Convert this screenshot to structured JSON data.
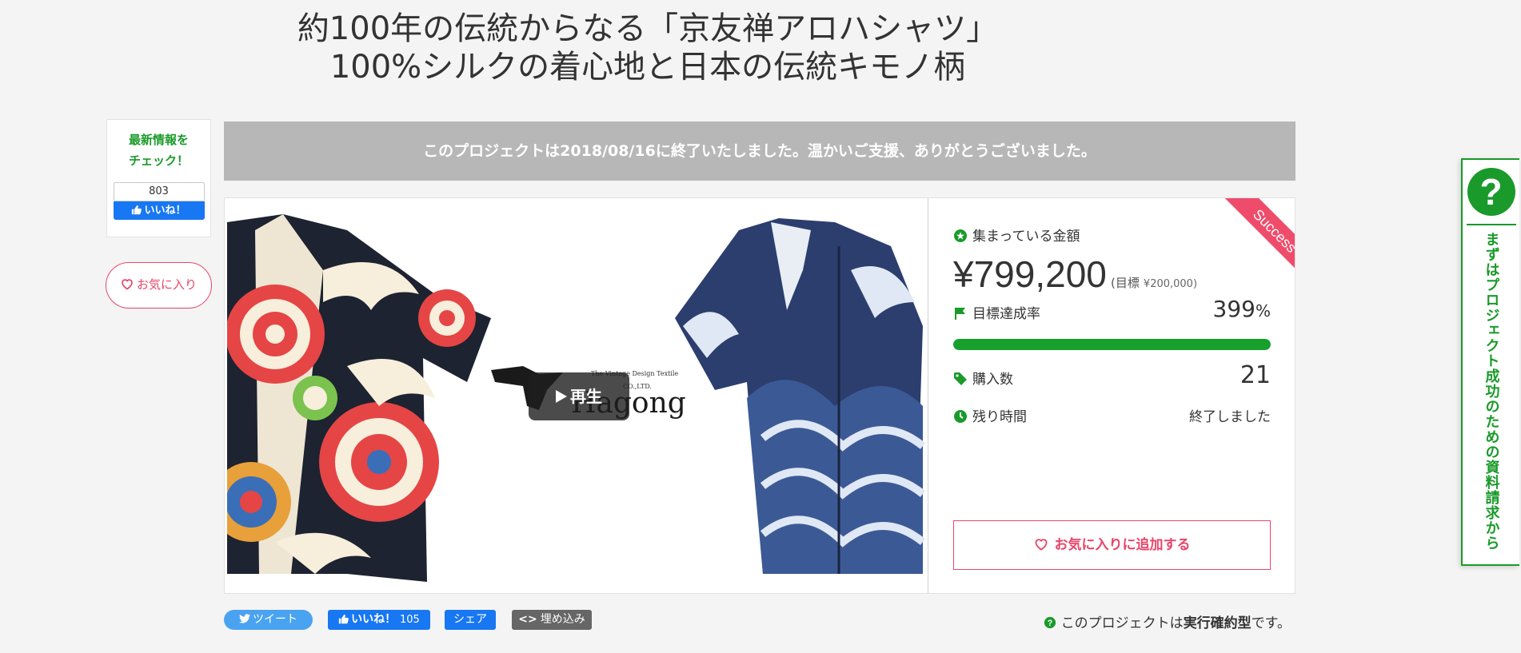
{
  "title": {
    "line1": "約100年の伝統からなる「京友禅アロハシャツ」",
    "line2": "100%シルクの着心地と日本の伝統キモノ柄"
  },
  "sidebar": {
    "latest_line1": "最新情報を",
    "latest_line2": "チェック！",
    "like_count": "803",
    "like_label": "いいね！",
    "favorite_label": "お気に入り"
  },
  "banner": {
    "ended_text": "このプロジェクトは2018/08/16に終了いたしました。温かいご支援、ありがとうございました。"
  },
  "video": {
    "play_label": "再生",
    "logo_text": "Hagong",
    "logo_sub1": "The Vintage Design Textile",
    "logo_sub2": "CO.,LTD."
  },
  "stats": {
    "status_ribbon": "Success",
    "raised_label": "集まっている金額",
    "raised_amount": "¥799,200",
    "goal_prefix": "(目標",
    "goal_amount": "¥200,000)",
    "rate_label": "目標達成率",
    "rate_value": "399",
    "rate_unit": "%",
    "progress": 1.0,
    "buyers_label": "購入数",
    "buyers_value": "21",
    "remaining_label": "残り時間",
    "remaining_value": "終了しました",
    "add_favorite_label": "お気に入りに追加する"
  },
  "share": {
    "tweet": "ツイート",
    "like": "いいね！",
    "like_count": "105",
    "share": "シェア",
    "embed": "埋め込み"
  },
  "footer_note": {
    "prefix": "このプロジェクトは",
    "bold": "実行確約型",
    "suffix": "です。"
  },
  "side_tab": {
    "icon": "?",
    "text": "まずはプロジェクト成功のための資料請求から"
  },
  "colors": {
    "green": "#1a9a2a",
    "pink": "#e8456a",
    "facebook": "#1877f2",
    "twitter": "#4aa3f0",
    "ended_banner": "#b7b7b7"
  }
}
